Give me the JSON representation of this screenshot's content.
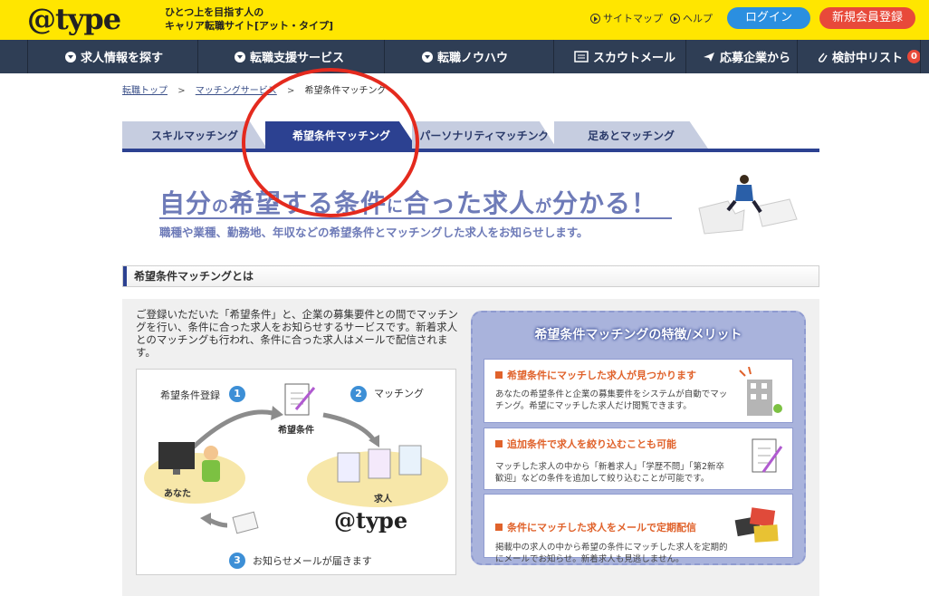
{
  "header": {
    "logo_text": "@type",
    "tagline_line1": "ひとつ上を目指す人の",
    "tagline_line2": "キャリア転職サイト[アット・タイプ]",
    "sitemap_label": "サイトマップ",
    "help_label": "ヘルプ",
    "login_label": "ログイン",
    "register_label": "新規会員登録"
  },
  "nav": {
    "items": [
      {
        "label": "求人情報を探す"
      },
      {
        "label": "転職支援サービス"
      },
      {
        "label": "転職ノウハウ"
      },
      {
        "label": "スカウトメール"
      },
      {
        "label": "応募企業から"
      },
      {
        "label": "検討中リスト"
      }
    ],
    "list_count": "0"
  },
  "breadcrumb": {
    "items": [
      "転職トップ",
      "マッチングサービス",
      "希望条件マッチング"
    ],
    "separator": ">"
  },
  "tabs": [
    {
      "label": "スキルマッチング"
    },
    {
      "label": "希望条件マッチング"
    },
    {
      "label": "パーソナリティマッチング"
    },
    {
      "label": "足あとマッチング"
    }
  ],
  "hero": {
    "p1": "自分",
    "p2": "の",
    "p3": "希望する条件",
    "p4": "に",
    "p5": "合った求人",
    "p6": "が",
    "p7": "分かる！",
    "subline": "職種や業種、勤務地、年収などの希望条件とマッチングした求人をお知らせします。"
  },
  "section": {
    "title": "希望条件マッチングとは",
    "description": "ご登録いただいた「希望条件」と、企業の募集要件との間でマッチングを行い、条件に合った求人をお知らせするサービスです。新着求人とのマッチングも行われ、条件に合った求人はメールで配信されます。"
  },
  "flow": {
    "step1_label": "希望条件登録",
    "step1_num": "1",
    "step2_label": "マッチング",
    "step2_num": "2",
    "step3_label": "お知らせメールが届きます",
    "step3_num": "3",
    "conditions_label": "希望条件",
    "you_label": "あなた",
    "jobs_label": "求人",
    "logo_text": "@type"
  },
  "features": {
    "title": "希望条件マッチングの特徴/メリット",
    "cards": [
      {
        "title": "希望条件にマッチした求人が見つかります",
        "body": "あなたの希望条件と企業の募集要件をシステムが自動でマッチング。希望にマッチした求人だけ閲覧できます。"
      },
      {
        "title": "追加条件で求人を絞り込むことも可能",
        "body": "マッチした求人の中から「新着求人」「学歴不問」「第2新卒歓迎」などの条件を追加して絞り込むことが可能です。"
      },
      {
        "title": "条件にマッチした求人をメールで定期配信",
        "body": "掲載中の求人の中から希望の条件にマッチした求人を定期的にメールでお知らせ。新着求人も見逃しません。"
      }
    ]
  },
  "colors": {
    "header_yellow": "#ffe600",
    "nav_navy": "#2f3e55",
    "tab_active": "#2c4191",
    "accent_orange": "#e0622b",
    "annotation_red": "#e42a1e"
  }
}
